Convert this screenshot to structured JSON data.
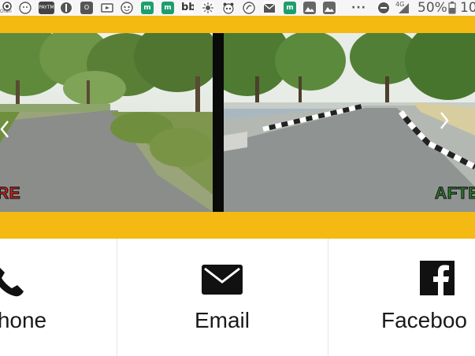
{
  "status_bar": {
    "network": "4G",
    "battery": "50%",
    "time": "10",
    "more": "···",
    "app_icons": [
      "orahi-app-icon",
      "paytm-app-icon",
      "camera-icon",
      "outlook-icon",
      "tv-icon",
      "face-icon",
      "meru-icon",
      "meru-icon",
      "bb-icon",
      "sun-icon",
      "panda-icon",
      "notification-icon",
      "gmail-icon",
      "meru-icon",
      "image-icon",
      "image-icon"
    ],
    "orahi_label": "Orahi",
    "paytm_label": "PAYTM"
  },
  "banner": {
    "before_label": "RE",
    "after_label": "AFTER",
    "colors": {
      "accent_yellow": "#f5b914",
      "before_red": "#d8201e",
      "after_green": "#2f7d2c",
      "divider": "#0a0a0a"
    }
  },
  "contacts": [
    {
      "label": "hone",
      "icon": "phone-icon"
    },
    {
      "label": "Email",
      "icon": "envelope-icon"
    },
    {
      "label": "Faceboo",
      "icon": "facebook-icon"
    }
  ]
}
